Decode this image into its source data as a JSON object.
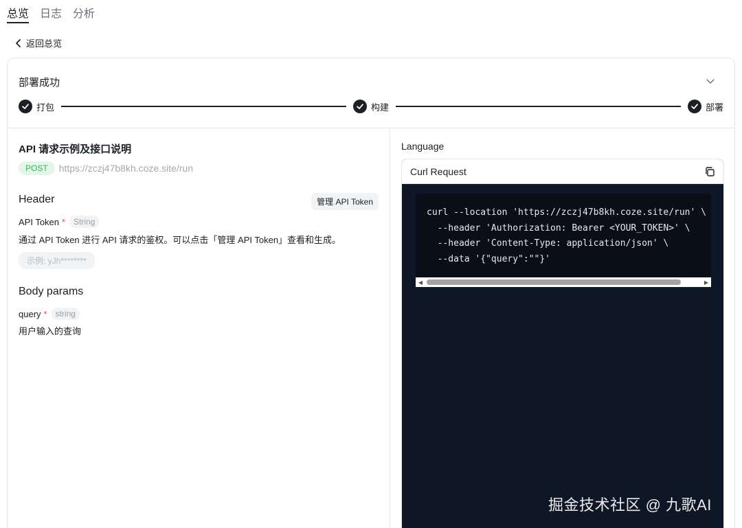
{
  "tabs": [
    {
      "label": "总览",
      "active": true
    },
    {
      "label": "日志",
      "active": false
    },
    {
      "label": "分析",
      "active": false
    }
  ],
  "back": {
    "label": "返回总览"
  },
  "deploy": {
    "status": "部署成功",
    "steps": [
      "打包",
      "构建",
      "部署"
    ]
  },
  "api": {
    "title": "API 请求示例及接口说明",
    "method": "POST",
    "url": "https://zczj47b8kh.coze.site/run"
  },
  "header_section": {
    "title": "Header",
    "manage_button": "管理 API Token",
    "param_name": "API Token",
    "required_mark": "*",
    "param_type": "String",
    "description": "通过 API Token 进行 API 请求的鉴权。可以点击「管理 API Token」查看和生成。",
    "example": "示例: yJh********"
  },
  "body_section": {
    "title": "Body params",
    "param_name": "query",
    "required_mark": "*",
    "param_type": "string",
    "description": "用户输入的查询"
  },
  "code": {
    "language_label": "Language",
    "request_title": "Curl Request",
    "snippet": "curl --location 'https://zczj47b8kh.coze.site/run' \\\n  --header 'Authorization: Bearer <YOUR_TOKEN>' \\\n  --header 'Content-Type: application/json' \\\n  --data '{\"query\":\"\"}'"
  },
  "watermark": "掘金技术社区 @ 九歌AI",
  "colors": {
    "accent": "#1c1f23",
    "post_badge_bg": "#e3f6e8",
    "post_badge_text": "#3bb35f",
    "code_bg": "#0e1726",
    "required": "#e5484d"
  }
}
